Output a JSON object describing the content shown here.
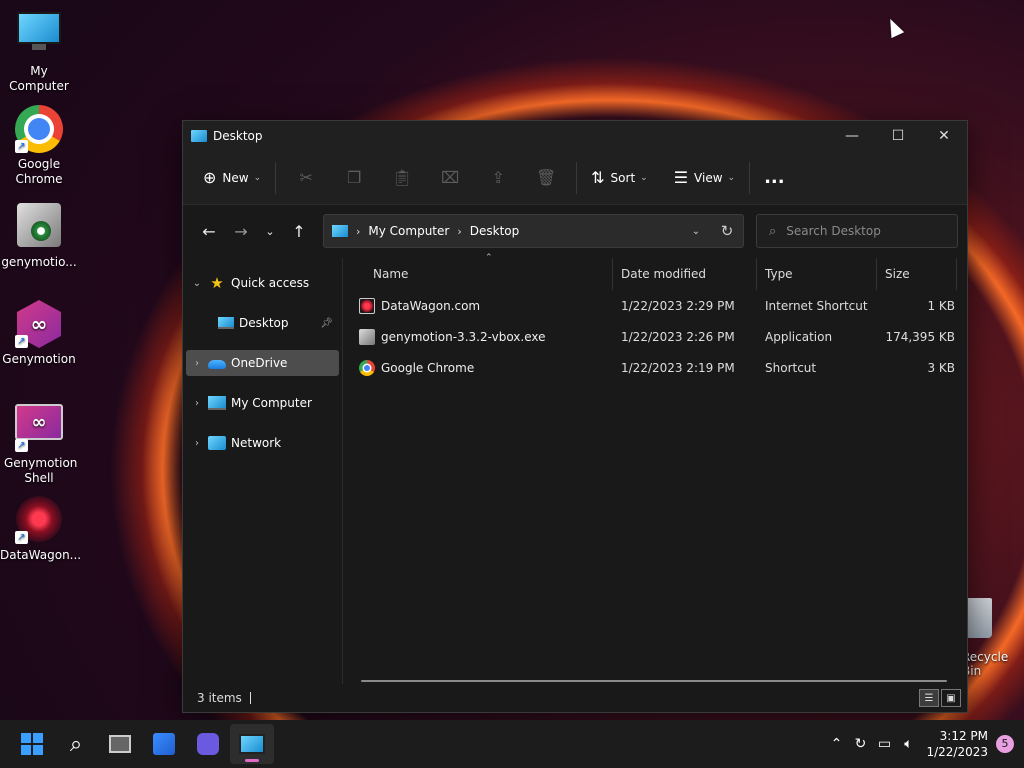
{
  "desktop": {
    "icons": [
      {
        "label": "My Computer"
      },
      {
        "label": "Google Chrome"
      },
      {
        "label": "genymotio..."
      },
      {
        "label": "Genymotion"
      },
      {
        "label": "Genymotion Shell"
      },
      {
        "label": "DataWagon..."
      }
    ],
    "recycle_bin_label": "Recycle Bin"
  },
  "window": {
    "title": "Desktop",
    "toolbar": {
      "new_label": "New",
      "sort_label": "Sort",
      "view_label": "View",
      "more_label": "..."
    },
    "address": {
      "crumbs": [
        "My Computer",
        "Desktop"
      ]
    },
    "search": {
      "placeholder": "Search Desktop"
    },
    "navpane": {
      "quick_access": "Quick access",
      "desktop": "Desktop",
      "onedrive": "OneDrive",
      "my_computer": "My Computer",
      "network": "Network"
    },
    "columns": {
      "name": "Name",
      "date": "Date modified",
      "type": "Type",
      "size": "Size"
    },
    "files": [
      {
        "name": "DataWagon.com",
        "date": "1/22/2023 2:29 PM",
        "type": "Internet Shortcut",
        "size": "1 KB"
      },
      {
        "name": "genymotion-3.3.2-vbox.exe",
        "date": "1/22/2023 2:26 PM",
        "type": "Application",
        "size": "174,395 KB"
      },
      {
        "name": "Google Chrome",
        "date": "1/22/2023 2:19 PM",
        "type": "Shortcut",
        "size": "3 KB"
      }
    ],
    "status": {
      "items_count": "3 items"
    }
  },
  "taskbar": {
    "time": "3:12 PM",
    "date": "1/22/2023",
    "notification_count": "5"
  }
}
